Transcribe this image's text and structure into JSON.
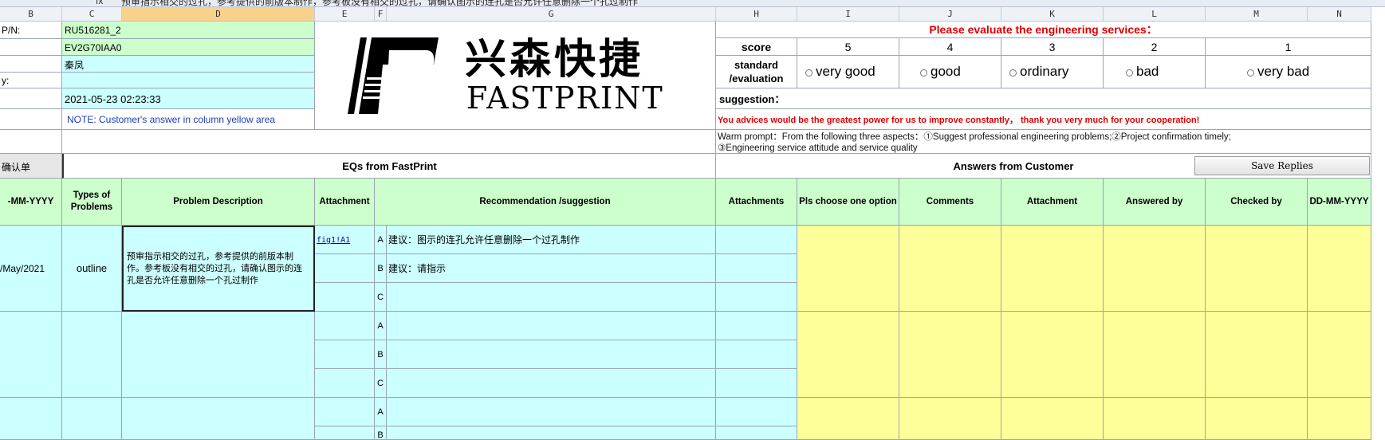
{
  "formula_bar": {
    "fx": "fx",
    "text": "预审指示相交的过孔，参考提供的前版本制作，参考板没有相交的过孔，请确认图示的连孔是否允许任意删除一个孔过制作"
  },
  "columns": [
    "B",
    "C",
    "D",
    "E",
    "F",
    "G",
    "H",
    "I",
    "J",
    "K",
    "L",
    "M",
    "N"
  ],
  "header": {
    "pn_label": "P/N:",
    "pn_value": "RU516281_2",
    "code_value": "EV2G70IAA0",
    "name_value": "秦凤",
    "by_label": "y:",
    "date_value": "2021-05-23 02:23:33",
    "note": "NOTE: Customer's  answer in column yellow area"
  },
  "logo": {
    "cn": "兴森快捷",
    "en": "FASTPRINT"
  },
  "evaluation": {
    "title": "Please evaluate the engineering services：",
    "score_label": "score",
    "scores": [
      "5",
      "4",
      "3",
      "2",
      "1"
    ],
    "standard_label": "standard /evaluation",
    "options": [
      "very good",
      "good",
      "ordinary",
      "bad",
      "very bad"
    ],
    "suggestion_label": "suggestion：",
    "advice": "You advices would be the greatest power for us to improve constantly，  thank you very much for your cooperation!",
    "warm_prompt_1": "Warm prompt：From the following three aspects：①Suggest professional engineering problems;②Project confirmation timely;",
    "warm_prompt_2": "③Engineering service attitude and service quality"
  },
  "sections": {
    "left_tab": "确认单",
    "eqs": "EQs from FastPrint",
    "answers": "Answers from Customer",
    "save_button": "Save Replies"
  },
  "table_headers": {
    "date": "-MM-YYYY",
    "types": "Types of Problems",
    "problem": "Problem Description",
    "attachment": "Attachment",
    "recommendation": "Recommendation /suggestion",
    "attachments": "Attachments",
    "choose": "Pls choose one option",
    "comments": "Comments",
    "attachment2": "Attachment",
    "answered_by": "Answered by",
    "checked_by": "Checked by",
    "dd": "DD-MM-YYYY"
  },
  "row1": {
    "date": "/May/2021",
    "type": "outline",
    "problem": "预审指示相交的过孔，参考提供的前版本制作。参考板没有相交的过孔，请确认图示的连孔是否允许任意删除一个孔过制作",
    "attachment_link": "fig1!A1",
    "options": [
      {
        "letter": "A",
        "text": "建议：图示的连孔允许任意删除一个过孔制作"
      },
      {
        "letter": "B",
        "text": "建议：请指示"
      },
      {
        "letter": "C",
        "text": ""
      }
    ]
  },
  "row2": {
    "options": [
      {
        "letter": "A"
      },
      {
        "letter": "B"
      },
      {
        "letter": "C"
      }
    ]
  },
  "row3": {
    "options": [
      {
        "letter": "A"
      },
      {
        "letter": "B"
      }
    ]
  }
}
